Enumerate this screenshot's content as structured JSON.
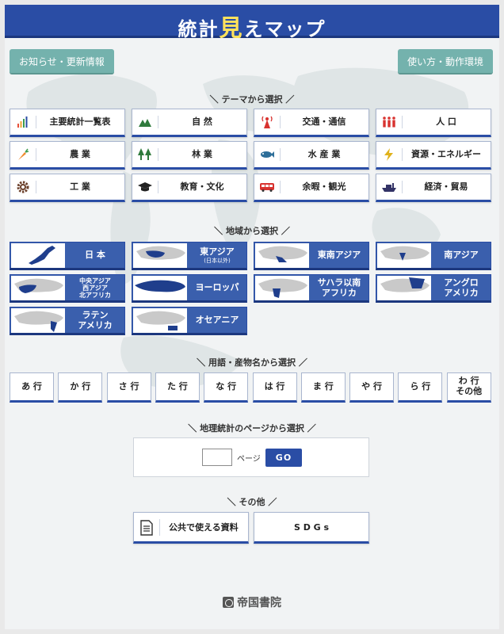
{
  "header": {
    "title_pre": "統計",
    "title_highlight": "見",
    "title_post": "えマップ"
  },
  "top_buttons": {
    "news": "お知らせ・更新情報",
    "usage": "使い方・動作環境"
  },
  "sections": {
    "theme": "＼ テーマから選択 ／",
    "region": "＼ 地域から選択 ／",
    "term": "＼ 用語・産物名から選択 ／",
    "page": "＼ 地理統計のページから選択 ／",
    "other": "＼ その他 ／"
  },
  "themes": [
    {
      "label": "主要統計一覧表",
      "icon": "bar-chart-icon",
      "color": "#e8503a"
    },
    {
      "label": "自 然",
      "icon": "mountain-icon",
      "color": "#2f7a3c"
    },
    {
      "label": "交通・通信",
      "icon": "antenna-icon",
      "color": "#d8322f"
    },
    {
      "label": "人 口",
      "icon": "people-icon",
      "color": "#d8322f"
    },
    {
      "label": "農 業",
      "icon": "carrot-icon",
      "color": "#ef8a2e"
    },
    {
      "label": "林 業",
      "icon": "trees-icon",
      "color": "#2f7a3c"
    },
    {
      "label": "水 産 業",
      "icon": "fish-icon",
      "color": "#2d6e99"
    },
    {
      "label": "資源・エネルギー",
      "icon": "lightning-icon",
      "color": "#e0b21c"
    },
    {
      "label": "工 業",
      "icon": "gear-icon",
      "color": "#6b3f2a"
    },
    {
      "label": "教育・文化",
      "icon": "graduation-cap-icon",
      "color": "#222222"
    },
    {
      "label": "余暇・観光",
      "icon": "bus-icon",
      "color": "#d8322f"
    },
    {
      "label": "経済・貿易",
      "icon": "ship-icon",
      "color": "#333366"
    }
  ],
  "regions": [
    {
      "label": "日 本",
      "sub": "",
      "small": false
    },
    {
      "label": "東アジア",
      "sub": "(日本以外)",
      "small": false
    },
    {
      "label": "東南アジア",
      "sub": "",
      "small": false
    },
    {
      "label": "南アジア",
      "sub": "",
      "small": false
    },
    {
      "label": "中央アジア\n西アジア\n北アフリカ",
      "sub": "",
      "small": true
    },
    {
      "label": "ヨーロッパ",
      "sub": "",
      "small": false
    },
    {
      "label": "サハラ以南\nアフリカ",
      "sub": "",
      "small": false
    },
    {
      "label": "アングロ\nアメリカ",
      "sub": "",
      "small": false
    },
    {
      "label": "ラテン\nアメリカ",
      "sub": "",
      "small": false
    },
    {
      "label": "オセアニア",
      "sub": "",
      "small": false
    }
  ],
  "kana": [
    "あ 行",
    "か 行",
    "さ 行",
    "た 行",
    "な 行",
    "は 行",
    "ま 行",
    "や 行",
    "ら 行",
    "わ 行\nその他"
  ],
  "page_search": {
    "input_value": "",
    "label": "ページ",
    "go": "GO"
  },
  "others": {
    "public": "公共で使える資料",
    "sdgs": "S D G s"
  },
  "footer": {
    "publisher": "帝国書院"
  },
  "colors": {
    "primary": "#2a4da5",
    "accent": "#74b2ad",
    "highlight": "#ffe25c"
  }
}
